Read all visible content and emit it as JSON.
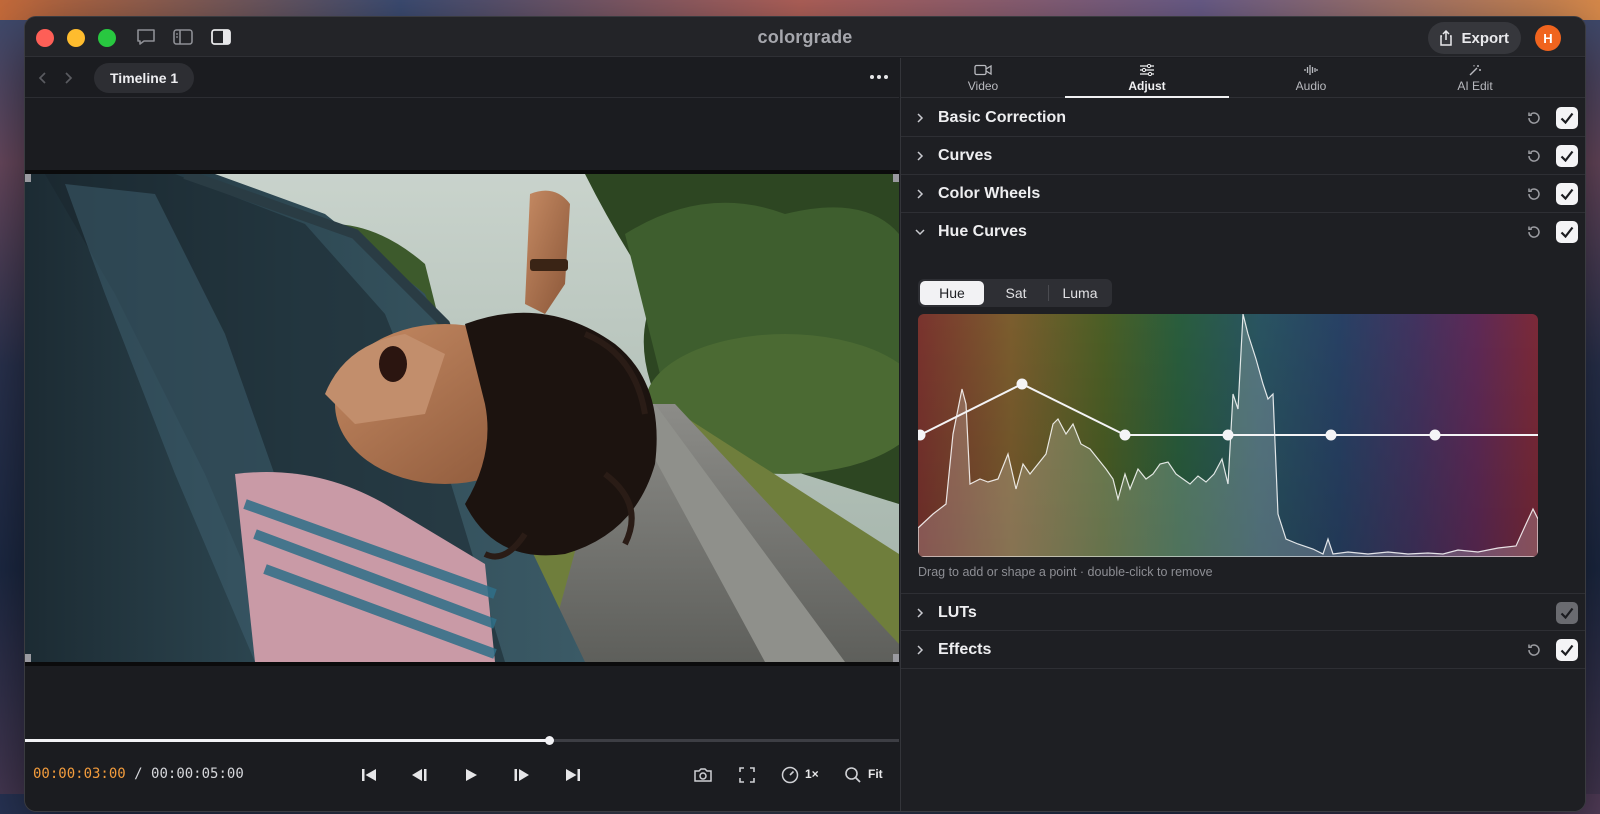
{
  "window": {
    "title": "colorgrade"
  },
  "header": {
    "export_label": "Export",
    "avatar_initial": "H"
  },
  "viewer": {
    "timeline_name": "Timeline 1",
    "current_time": "00:00:03:00",
    "separator": "/",
    "total_time": "00:00:05:00",
    "progress": 0.6,
    "speed_label": "1×",
    "zoom_label": "Fit"
  },
  "inspector": {
    "tabs": [
      {
        "label": "Video",
        "icon": "video-camera-icon"
      },
      {
        "label": "Adjust",
        "icon": "sliders-icon",
        "active": true
      },
      {
        "label": "Audio",
        "icon": "waveform-icon"
      },
      {
        "label": "AI Edit",
        "icon": "magic-wand-icon"
      }
    ],
    "sections": [
      {
        "title": "Basic Correction",
        "expanded": false,
        "enabled": true
      },
      {
        "title": "Curves",
        "expanded": false,
        "enabled": true
      },
      {
        "title": "Color Wheels",
        "expanded": false,
        "enabled": true
      },
      {
        "title": "Hue Curves",
        "expanded": true,
        "enabled": true
      },
      {
        "title": "LUTs",
        "expanded": false,
        "enabled": true
      },
      {
        "title": "Effects",
        "expanded": false,
        "enabled": true
      }
    ],
    "hue_curves": {
      "modes": [
        "Hue",
        "Sat",
        "Luma"
      ],
      "active_mode": "Hue",
      "hint": "Drag to add or shape a point · double-click to remove"
    }
  },
  "colors": {
    "accent_timecode": "#f39c3c",
    "avatar_bg": "#f0641e",
    "close": "#fe5f57",
    "minimize": "#febc2e",
    "zoom": "#28c840"
  }
}
